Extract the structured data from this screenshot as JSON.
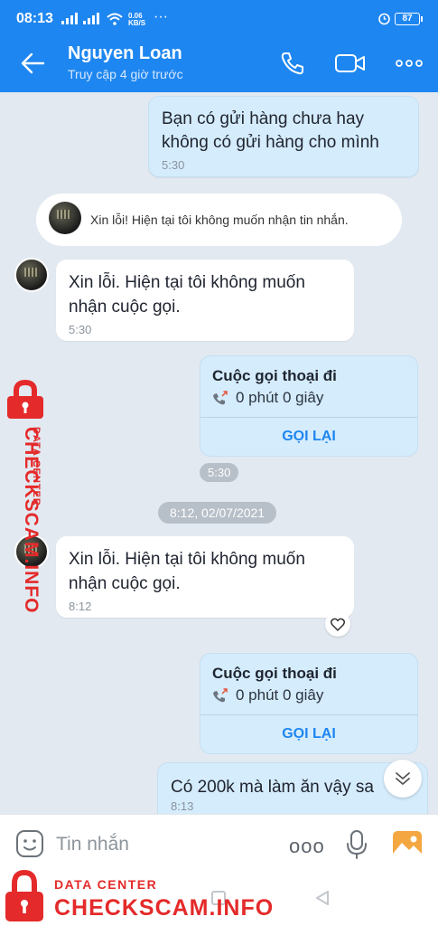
{
  "status_bar": {
    "time": "08:13",
    "net_speed_value": "0.06",
    "net_speed_unit": "KB/S",
    "more": "···",
    "battery": "87"
  },
  "header": {
    "name": "Nguyen Loan",
    "status": "Truy cập 4 giờ trước"
  },
  "messages": [
    {
      "type": "outgoing",
      "text": "Bạn có gửi hàng chưa hay không có gửi hàng cho mình",
      "time": "5:30"
    },
    {
      "type": "system",
      "text": "Xin lỗi! Hiện tại tôi không muốn nhận tin nhắn."
    },
    {
      "type": "incoming",
      "text": "Xin lỗi. Hiện tại tôi không muốn nhận cuộc gọi.",
      "time": "5:30"
    },
    {
      "type": "call",
      "title": "Cuộc gọi thoại đi",
      "duration": "0 phút 0 giây",
      "action": "GỌI LẠI",
      "time": "5:30"
    },
    {
      "type": "date_separator",
      "text": "8:12, 02/07/2021"
    },
    {
      "type": "incoming",
      "text": "Xin lỗi. Hiện tại tôi không muốn nhận cuộc gọi.",
      "time": "8:12"
    },
    {
      "type": "call",
      "title": "Cuộc gọi thoại đi",
      "duration": "0 phút 0 giây",
      "action": "GỌI LẠI"
    },
    {
      "type": "outgoing",
      "text": "Có 200k mà làm ăn vậy sa",
      "time": "8:13"
    }
  ],
  "input": {
    "placeholder": "Tin nhắn",
    "more": "ooo"
  },
  "watermark": {
    "small": "DATA CENTER",
    "big": "CHECKSCAM.INFO"
  },
  "colors": {
    "header": "#1e86f0",
    "outgoing_bubble": "#d5ecfc",
    "incoming_bubble": "#ffffff",
    "chat_bg": "#e2e9f1",
    "watermark": "#e42a2a"
  },
  "icons": [
    "back-arrow-icon",
    "phone-icon",
    "video-camera-icon",
    "more-icon",
    "missed-call-icon",
    "heart-icon",
    "scroll-down-icon",
    "emoji-icon",
    "microphone-icon",
    "image-icon",
    "lock-icon"
  ]
}
